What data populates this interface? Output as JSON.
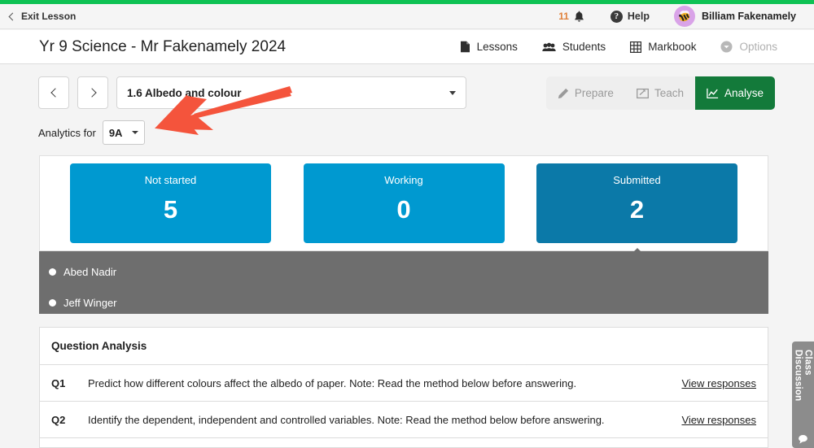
{
  "theme": {
    "brand_green": "#0ec254",
    "active_green": "#137a3a",
    "card_blue": "#0099d0",
    "card_blue_dark": "#0b79a8",
    "panel_gray": "#6e6e6e",
    "annotation_red": "#f4543c",
    "notif_orange": "#e0823c",
    "avatar_purple": "#d9a3e8"
  },
  "utility_bar": {
    "exit_label": "Exit Lesson",
    "exit_icon": "chevron-left-icon",
    "notification_count": "11",
    "notification_icon": "bell-icon",
    "help_label": "Help",
    "help_icon": "question-circle-icon",
    "user_name": "Billiam Fakenamely",
    "avatar_icon": "bee-avatar-icon"
  },
  "header": {
    "title": "Yr 9 Science - Mr Fakenamely 2024",
    "nav": [
      {
        "label": "Lessons",
        "icon": "document-icon",
        "active": false,
        "disabled": false
      },
      {
        "label": "Students",
        "icon": "people-icon",
        "active": false,
        "disabled": false
      },
      {
        "label": "Markbook",
        "icon": "grid-icon",
        "active": false,
        "disabled": false
      },
      {
        "label": "Options",
        "icon": "chevron-circle-down-icon",
        "active": false,
        "disabled": true
      }
    ]
  },
  "lesson_row": {
    "prev_icon": "chevron-left-icon",
    "next_icon": "chevron-right-icon",
    "selected_lesson": "1.6 Albedo and colour",
    "dropdown_icon": "caret-down-icon"
  },
  "mode_group": {
    "modes": [
      {
        "label": "Prepare",
        "icon": "pencil-icon",
        "active": false
      },
      {
        "label": "Teach",
        "icon": "present-icon",
        "active": false
      },
      {
        "label": "Analyse",
        "icon": "line-chart-icon",
        "active": true
      }
    ]
  },
  "analytics": {
    "label": "Analytics for",
    "selected_class": "9A",
    "dropdown_icon": "caret-down-icon"
  },
  "status_cards": [
    {
      "label": "Not started",
      "value": "5",
      "color": "#0099d0",
      "selected": false
    },
    {
      "label": "Working",
      "value": "0",
      "color": "#0099d0",
      "selected": false
    },
    {
      "label": "Submitted",
      "value": "2",
      "color": "#0b79a8",
      "selected": true
    }
  ],
  "student_list": [
    {
      "name": "Abed Nadir",
      "status_icon": "status-dot-icon"
    },
    {
      "name": "Jeff Winger",
      "status_icon": "status-dot-icon"
    }
  ],
  "question_analysis": {
    "header": "Question Analysis",
    "rows": [
      {
        "number": "Q1",
        "text": "Predict how different colours affect the albedo of paper. Note: Read the method below before answering.",
        "link": "View responses"
      },
      {
        "number": "Q2",
        "text": "Identify the dependent, independent and controlled variables. Note: Read the method below before answering.",
        "link": "View responses"
      }
    ]
  },
  "side_tab": {
    "label": "Class Discussion",
    "icon": "speech-bubble-icon"
  },
  "annotation": {
    "type": "arrow",
    "points_to": "class-select",
    "color": "#f4543c"
  }
}
